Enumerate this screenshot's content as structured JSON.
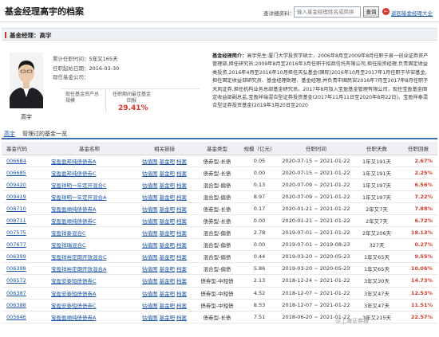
{
  "header": {
    "title": "基金经理高宇的档案",
    "query_label": "查详细资料：",
    "query_placeholder": "输入基金经理姓名或简拼",
    "query_button": "查询",
    "back_link": "返回基金经理大全"
  },
  "manager": {
    "section_title": "基金经理：高宇",
    "name": "高宇",
    "info": [
      {
        "label": "累计任职时间：",
        "value": "5年又165天"
      },
      {
        "label": "任职起始日期：",
        "value": "2016-03-30"
      },
      {
        "label": "现任基金公司：",
        "value": ""
      }
    ],
    "stat1_label": "现任基金资产总规模",
    "stat2_label": "任职期间最佳基金回报",
    "stat2_value": "29.41%",
    "bio_heading": "基金经理简介：",
    "bio_text": "高宇先生:厦门大学投资学硕士，2006年8月至2009年8月任职于泉一创业证券资产管理部,担任研究员;2009年8月至2016年3月任职于招商信托有限公司,担任投资经理,负责固定收益类投资,2016年4月至2016年10月担任天弘基金(国际)2016年10月至2017年1月任职于华安基金,担任固定收益部研究员、基金经理助理、基金经理,并负责中国民安2016年7月至2017年8月任职于天风证券,担任机构业务总部基金研究员。2017年8月加入宝盈基金管理有限公司，现任宝盈基金固定收益部副总监,宝盈祥瑞混合型证券投资基金(2017年11月11日至2020年8月22日)、宝盈祥泰混合型证券投资基金(2019年3月20日至2020"
  },
  "fund_list": {
    "manager_name": "高宇",
    "title_suffix": "管理过的基金一览",
    "columns": [
      "基金代码",
      "基金名称",
      "相关链接",
      "基金类型",
      "规模（亿元）",
      "任职时间",
      "任职天数",
      "任职回报"
    ],
    "link_labels": [
      "估值图",
      "基金吧",
      "档案"
    ],
    "rows": [
      {
        "code": "006684",
        "name": "宝盈盈邦纯债债券A",
        "type": "债券型-长债",
        "scale": "0.05",
        "period": "2020-07-15 ~ 2021-01-22",
        "days": "1年又191天",
        "ret": "2.67%"
      },
      {
        "code": "006685",
        "name": "宝盈盈邦纯债债券C",
        "type": "债券型-长债",
        "scale": "0.00",
        "period": "2020-07-15 ~ 2021-01-22",
        "days": "1年又191天",
        "ret": "2.25%"
      },
      {
        "code": "009420",
        "name": "宝盈祥明一年定开混合C",
        "type": "混合型-偏债",
        "scale": "0.13",
        "period": "2020-07-09 ~ 2021-01-22",
        "days": "1年又197天",
        "ret": "6.56%"
      },
      {
        "code": "009419",
        "name": "宝盈祥明一年定开混合A",
        "type": "混合型-偏债",
        "scale": "8.97",
        "period": "2020-07-09 ~ 2021-01-22",
        "days": "1年又197天",
        "ret": "7.22%"
      },
      {
        "code": "008710",
        "name": "宝盈盈顺纯债债券A",
        "type": "债券型-长债",
        "scale": "0.17",
        "period": "2020-01-21 ~ 2021-01-22",
        "days": "2年又7天",
        "ret": "7.88%"
      },
      {
        "code": "008711",
        "name": "宝盈盈顺纯债债券C",
        "type": "债券型-长债",
        "scale": "0.00",
        "period": "2020-01-21 ~ 2021-01-22",
        "days": "2年又7天",
        "ret": "6.72%"
      },
      {
        "code": "007575",
        "name": "宝盈祥泰混合C",
        "type": "混合型-偏债",
        "scale": "2.78",
        "period": "2019-07-01 ~ 2021-01-22",
        "days": "2年又206天",
        "ret": "18.13%"
      },
      {
        "code": "007677",
        "name": "宝盈祥瑞混合C",
        "type": "混合型-偏债",
        "scale": "0.00",
        "period": "2019-07-01 ~ 2019-08-23",
        "days": "327天",
        "ret": "0.27%"
      },
      {
        "code": "006399",
        "name": "宝盈祥裕定期开放混合C",
        "type": "混合型-偏债",
        "scale": "0.44",
        "period": "2019-03-20 ~ 2020-05-23",
        "days": "1年又65天",
        "ret": "9.55%"
      },
      {
        "code": "006398",
        "name": "宝盈祥裕定期开放混合A",
        "type": "混合型-偏债",
        "scale": "5.86",
        "period": "2019-03-20 ~ 2020-05-23",
        "days": "1年又65天",
        "ret": "10.06%"
      },
      {
        "code": "006572",
        "name": "宝盈安泰短债债券C",
        "type": "债券型-中短债",
        "scale": "2.13",
        "period": "2018-12-24 ~ 2021-01-22",
        "days": "3年又30天",
        "ret": "14.73%"
      },
      {
        "code": "006387",
        "name": "宝盈安泰短债债券A",
        "type": "债券型-中短债",
        "scale": "4.52",
        "period": "2018-12-07 ~ 2021-01-22",
        "days": "3年又47天",
        "ret": "12.53%"
      },
      {
        "code": "006388",
        "name": "宝盈安泰短债债券C",
        "type": "债券型-中短债",
        "scale": "8.53",
        "period": "2018-12-07 ~ 2021-01-22",
        "days": "3年又47天",
        "ret": "11.51%"
      },
      {
        "code": "005646",
        "name": "宝盈盈顺纯债债券A",
        "type": "债券型-长债",
        "scale": "7.51",
        "period": "2018-06-20 ~ 2021-01-22",
        "days": "3年又215天",
        "ret": "22.57%"
      }
    ]
  },
  "watermark": "@上海证券报",
  "colors": {
    "accent_red": "#d23a2a",
    "link_blue": "#1a55a6",
    "section_bar": "#c0392b"
  }
}
